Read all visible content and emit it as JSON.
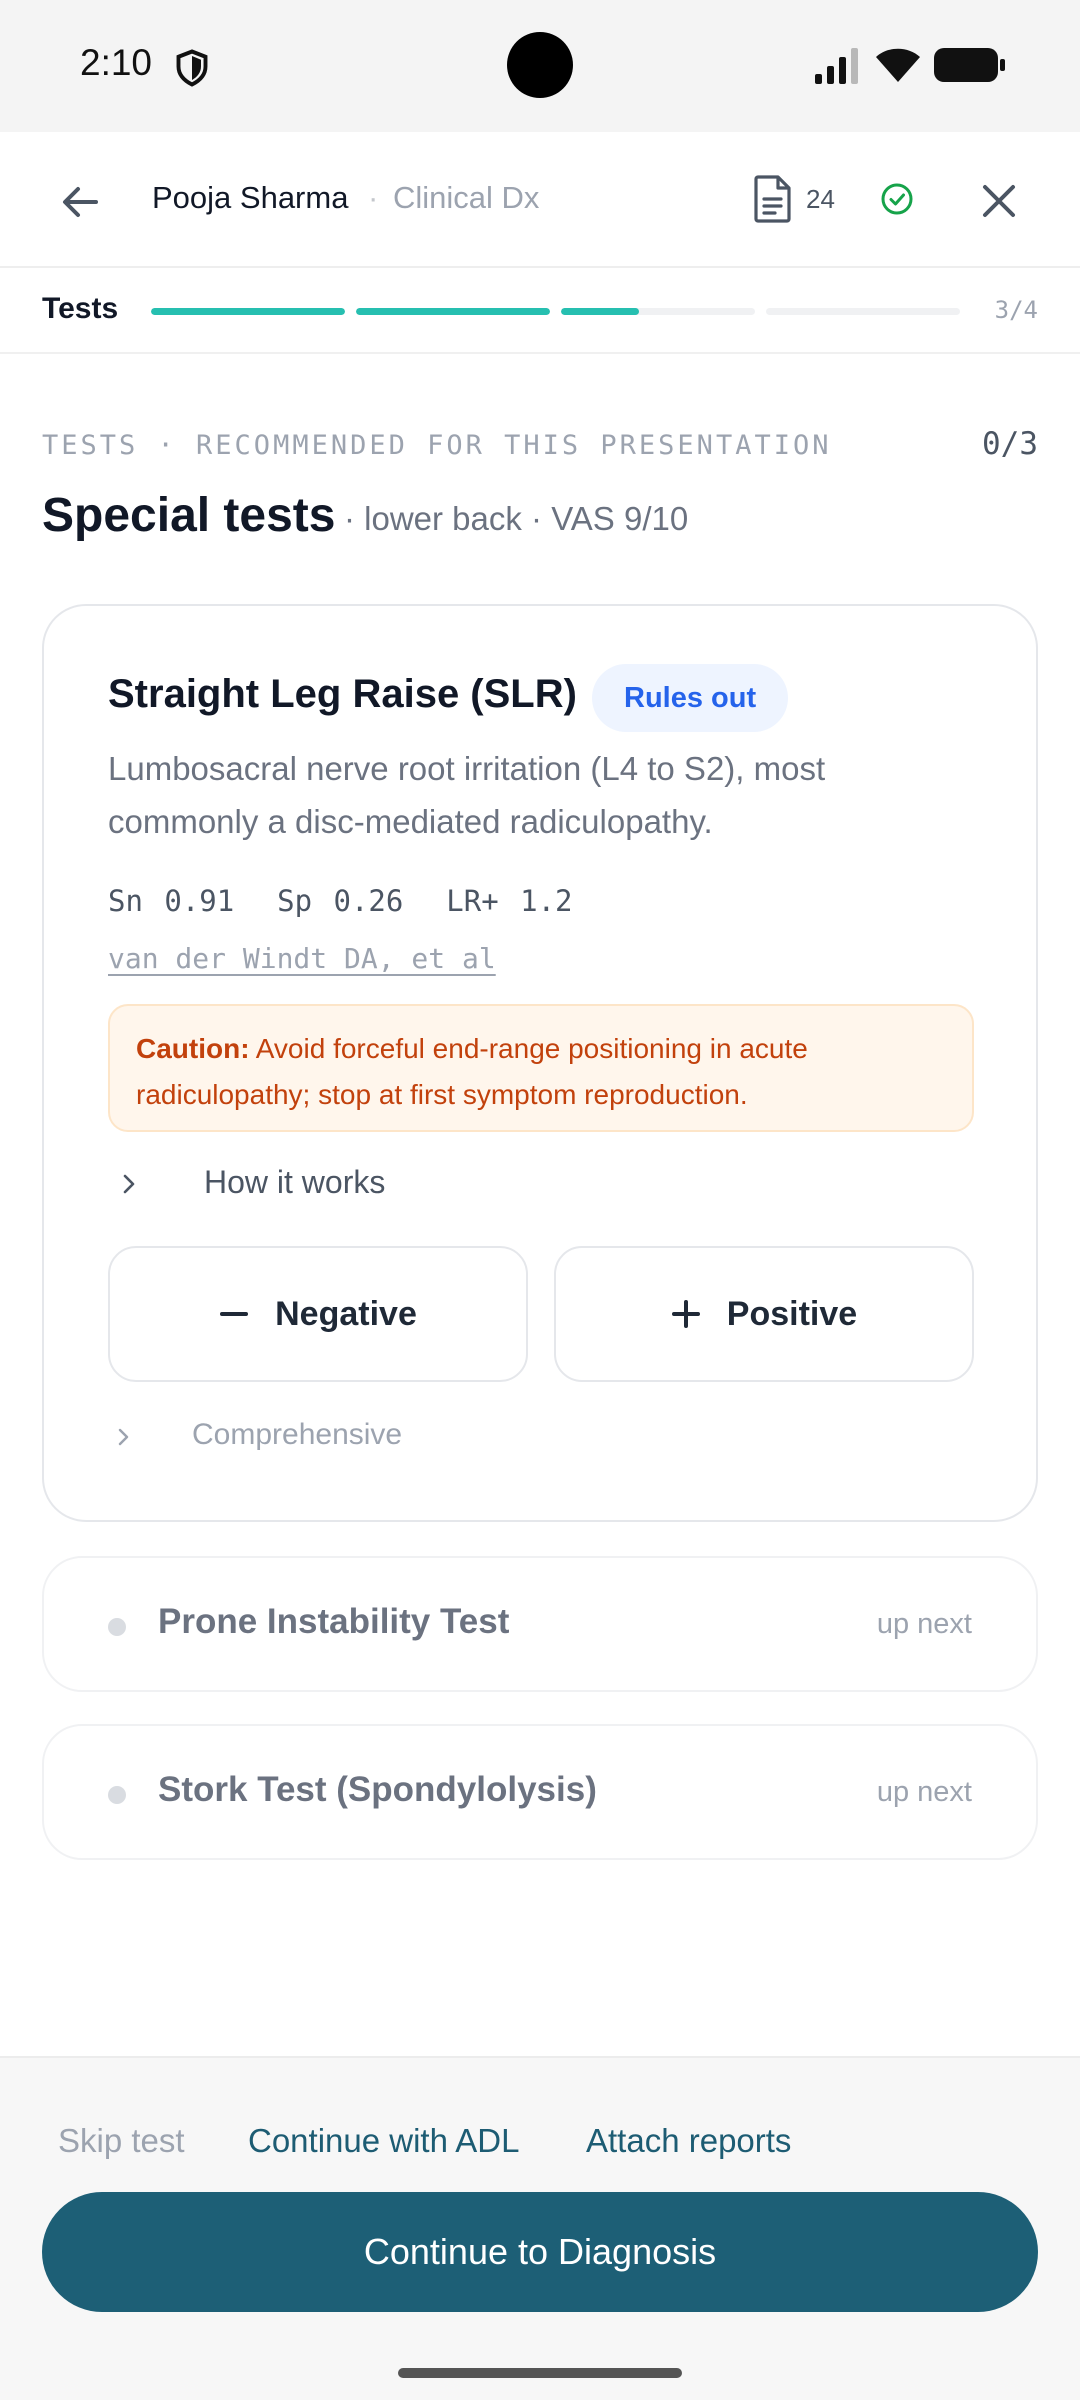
{
  "status_bar": {
    "time": "2:10",
    "icons": [
      "shield-icon",
      "signal-icon",
      "wifi-icon",
      "battery-icon"
    ]
  },
  "header": {
    "patient_name": "Pooja Sharma",
    "separator": "·",
    "context": "Clinical Dx",
    "document_count": "24",
    "icons": [
      "back-arrow-icon",
      "document-icon",
      "check-circle-icon",
      "close-icon"
    ]
  },
  "progress": {
    "label": "Tests",
    "count": "3/4",
    "segments": [
      1,
      1,
      0.4,
      0,
      0
    ],
    "color": "#26bfb0"
  },
  "section": {
    "eyebrow": "TESTS · RECOMMENDED FOR THIS PRESENTATION",
    "counter": "0/3",
    "title": "Special tests",
    "meta": "· lower back · VAS 9/10"
  },
  "current_test": {
    "name": "Straight Leg Raise (SLR)",
    "badge": "Rules out",
    "description": "Lumbosacral nerve root irritation (L4 to S2), most commonly a disc-mediated radiculopathy.",
    "stats": "Sn 0.91  Sp 0.26  LR+ 1.2",
    "citation": "van der Windt DA, et al",
    "caution_label": "Caution:",
    "caution_text": "Avoid forceful end-range positioning in acute radiculopathy; stop at first symptom reproduction.",
    "how_it_works": "How it works",
    "negative_label": "Negative",
    "positive_label": "Positive",
    "comprehensive": "Comprehensive"
  },
  "up_next": [
    {
      "name": "Prone Instability Test",
      "tag": "up next"
    },
    {
      "name": "Stork Test (Spondylolysis)",
      "tag": "up next"
    }
  ],
  "footer": {
    "skip": "Skip test",
    "continue_adl": "Continue with ADL",
    "attach": "Attach reports",
    "primary_cta": "Continue to Diagnosis"
  },
  "colors": {
    "accent": "#26bfb0",
    "primary": "#1d5f76",
    "badge": "#2563eb",
    "caution": "#c2410c"
  }
}
